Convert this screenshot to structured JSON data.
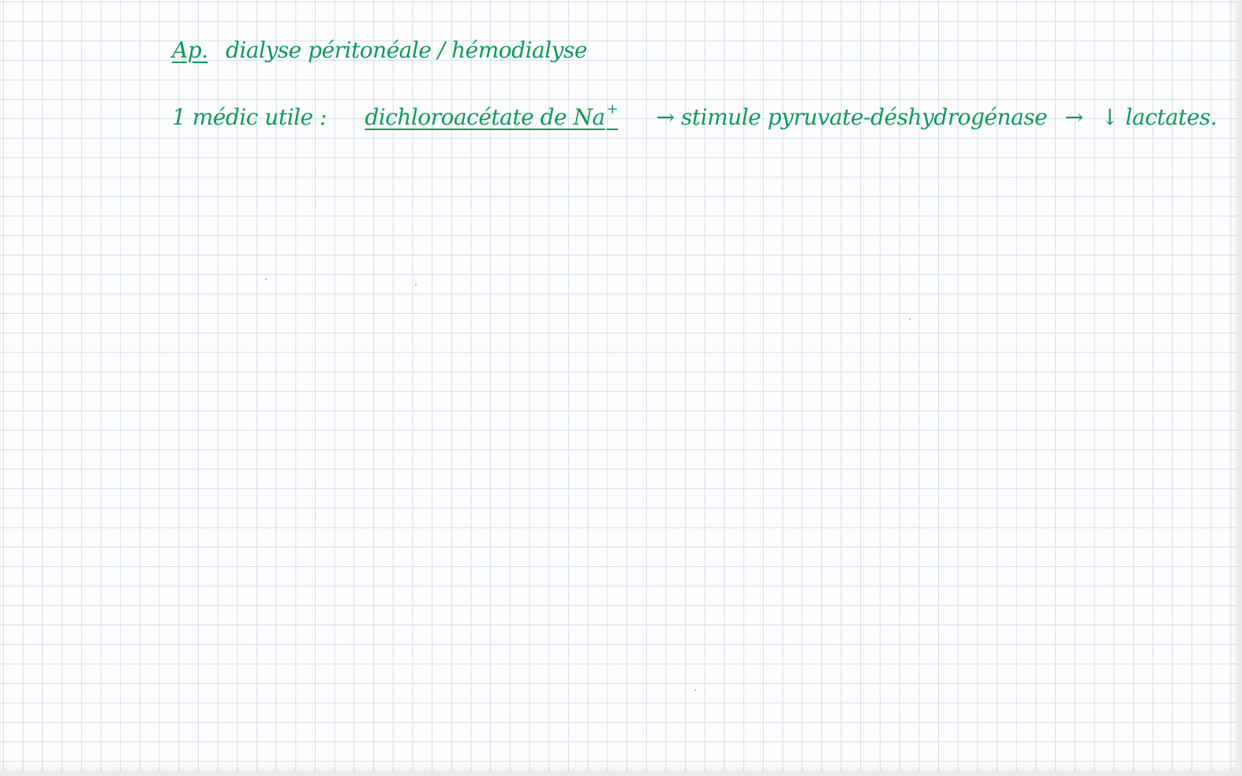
{
  "note": {
    "line1": {
      "abbrev": "Ap.",
      "text": "dialyse péritonéale / hémodialyse"
    },
    "line2": {
      "prefix": "1 médic utile :",
      "drug": "dichloroacétate de Na",
      "drug_charge": "+",
      "arrow1": "→",
      "effect": "stimule pyruvate-déshydrogénase",
      "arrow2": "→",
      "down_arrow": "↓",
      "result": "lactates."
    }
  },
  "colors": {
    "ink": "#0f9a5a",
    "grid": "#b4c8e6",
    "paper": "#fdfdfd"
  }
}
